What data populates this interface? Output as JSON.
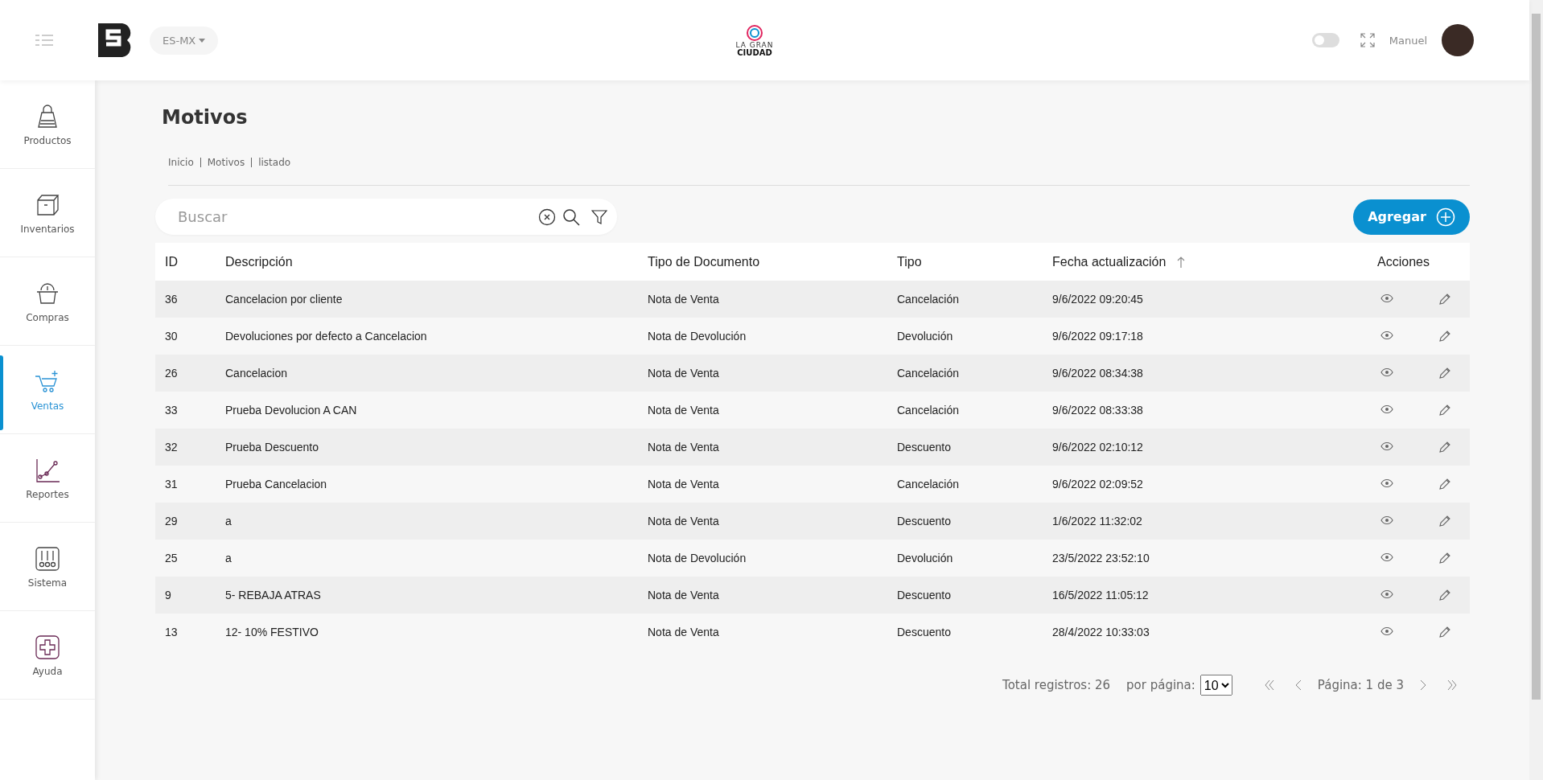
{
  "header": {
    "language": "ES-MX",
    "logo_text": [
      "LA GRAN",
      "CIUDAD"
    ],
    "dark_mode": {
      "on": false
    },
    "user": "Manuel"
  },
  "sidebar": {
    "items": [
      {
        "label": "Productos",
        "kind": "bag",
        "selected": false
      },
      {
        "label": "Inventarios",
        "kind": "box",
        "selected": false
      },
      {
        "label": "Compras",
        "kind": "basket",
        "selected": false
      },
      {
        "label": "Ventas",
        "kind": "cart",
        "selected": true
      },
      {
        "label": "Reportes",
        "kind": "chart",
        "selected": false
      },
      {
        "label": "Sistema",
        "kind": "sliders",
        "selected": false
      },
      {
        "label": "Ayuda",
        "kind": "help",
        "selected": false
      }
    ]
  },
  "page": {
    "title": "Motivos",
    "breadcrumb": [
      "Inicio",
      "Motivos",
      "listado"
    ]
  },
  "search": {
    "placeholder": "Buscar"
  },
  "add_button": "Agregar",
  "table": {
    "columns": [
      {
        "label": "ID",
        "sorted": false
      },
      {
        "label": "Descripción",
        "sorted": false
      },
      {
        "label": "Tipo de Documento",
        "sorted": false
      },
      {
        "label": "Tipo",
        "sorted": false
      },
      {
        "label": "Fecha actualización",
        "sorted": true
      },
      {
        "label": "Acciones",
        "sorted": false
      }
    ],
    "rows": [
      [
        "36",
        "Cancelacion por cliente",
        "Nota de Venta",
        "Cancelación",
        "9/6/2022 09:20:45"
      ],
      [
        "30",
        "Devoluciones por defecto a Cancelacion",
        "Nota de Devolución",
        "Devolución",
        "9/6/2022 09:17:18"
      ],
      [
        "26",
        "Cancelacion",
        "Nota de Venta",
        "Cancelación",
        "9/6/2022 08:34:38"
      ],
      [
        "33",
        "Prueba Devolucion A CAN",
        "Nota de Venta",
        "Cancelación",
        "9/6/2022 08:33:38"
      ],
      [
        "32",
        "Prueba Descuento",
        "Nota de Venta",
        "Descuento",
        "9/6/2022 02:10:12"
      ],
      [
        "31",
        "Prueba Cancelacion",
        "Nota de Venta",
        "Cancelación",
        "9/6/2022 02:09:52"
      ],
      [
        "29",
        "a",
        "Nota de Venta",
        "Descuento",
        "1/6/2022 11:32:02"
      ],
      [
        "25",
        "a",
        "Nota de Devolución",
        "Devolución",
        "23/5/2022 23:52:10"
      ],
      [
        "9",
        "5- REBAJA ATRAS",
        "Nota de Venta",
        "Descuento",
        "16/5/2022 11:05:12"
      ],
      [
        "13",
        "12- 10% FESTIVO",
        "Nota de Venta",
        "Descuento",
        "28/4/2022 10:33:03"
      ]
    ]
  },
  "pagination": {
    "total": "Total registros: 26",
    "per_page_label": "por página:",
    "per_page": "10",
    "page": "Página: 1 de 3"
  }
}
